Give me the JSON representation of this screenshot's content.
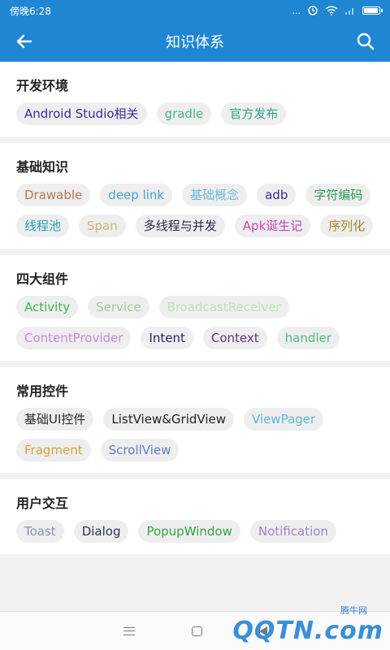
{
  "status": {
    "time": "傍晚6:28",
    "dots": "...",
    "battery_level": 0.85
  },
  "appbar": {
    "title": "知识体系",
    "back_icon": "arrow-left-icon",
    "search_icon": "search-icon"
  },
  "sections": [
    {
      "title": "开发环境",
      "chips": [
        {
          "label": "Android Studio相关",
          "color": "#3a2b9a"
        },
        {
          "label": "gradle",
          "color": "#49b87f"
        },
        {
          "label": "官方发布",
          "color": "#2fa38a"
        }
      ]
    },
    {
      "title": "基础知识",
      "chips": [
        {
          "label": "Drawable",
          "color": "#b07857"
        },
        {
          "label": "deep link",
          "color": "#4aa5c8"
        },
        {
          "label": "基础概念",
          "color": "#6db8dc"
        },
        {
          "label": "adb",
          "color": "#362d96"
        },
        {
          "label": "字符编码",
          "color": "#2f9a55"
        },
        {
          "label": "线程池",
          "color": "#2ba0b0"
        },
        {
          "label": "Span",
          "color": "#d0b27a"
        },
        {
          "label": "多线程与并发",
          "color": "#2d2d4a"
        },
        {
          "label": "Apk诞生记",
          "color": "#c646b6"
        },
        {
          "label": "序列化",
          "color": "#a8892a"
        }
      ]
    },
    {
      "title": "四大组件",
      "chips": [
        {
          "label": "Activity",
          "color": "#3db845"
        },
        {
          "label": "Service",
          "color": "#9ccd9c"
        },
        {
          "label": "BroadcastReceiver",
          "color": "#bfe0bf"
        },
        {
          "label": "ContentProvider",
          "color": "#c98bd6"
        },
        {
          "label": "Intent",
          "color": "#2a1f5a"
        },
        {
          "label": "Context",
          "color": "#6a2d7a"
        },
        {
          "label": "handler",
          "color": "#4cbf7c"
        }
      ]
    },
    {
      "title": "常用控件",
      "chips": [
        {
          "label": "基础UI控件",
          "color": "#2a2a2a"
        },
        {
          "label": "ListView&GridView",
          "color": "#222222"
        },
        {
          "label": "ViewPager",
          "color": "#5bb9d8"
        },
        {
          "label": "Fragment",
          "color": "#d2a43a"
        },
        {
          "label": "ScrollView",
          "color": "#5b7fb8"
        }
      ]
    },
    {
      "title": "用户交互",
      "chips": [
        {
          "label": "Toast",
          "color": "#8895a8"
        },
        {
          "label": "Dialog",
          "color": "#2d3550"
        },
        {
          "label": "PopupWindow",
          "color": "#36a53a"
        },
        {
          "label": "Notification",
          "color": "#9a86c2"
        }
      ]
    }
  ],
  "navbar": {
    "menu_icon": "menu-icon",
    "home_icon": "home-icon",
    "back_icon": "back-icon"
  },
  "watermark": {
    "small": "腾牛网",
    "big": "QQTN.com"
  }
}
